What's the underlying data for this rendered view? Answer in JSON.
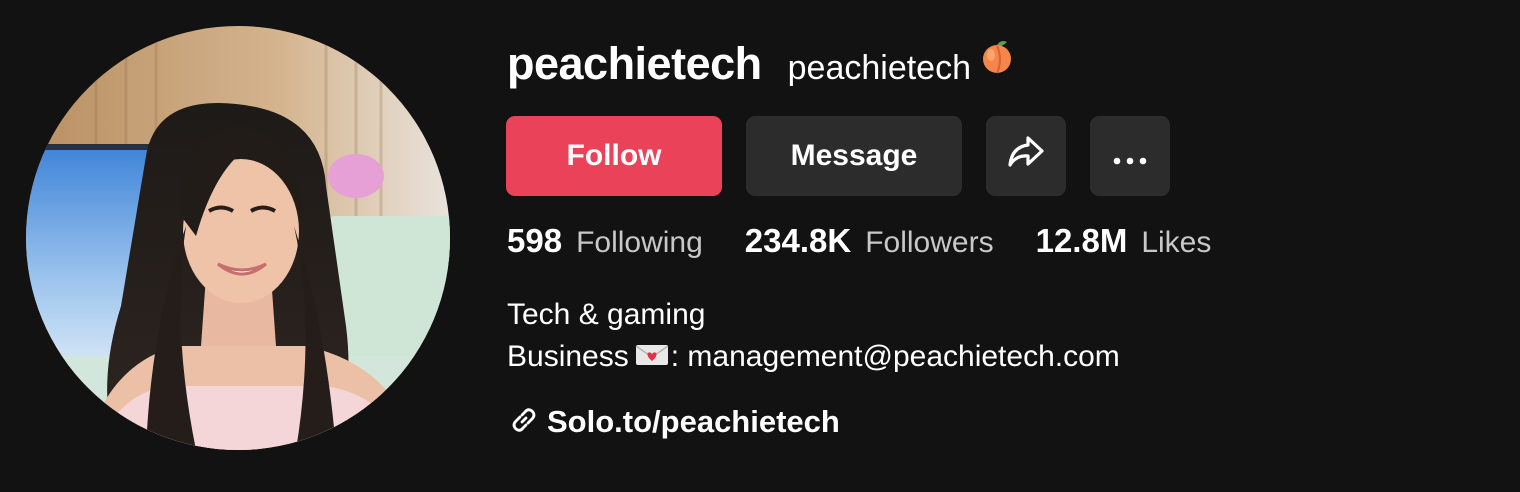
{
  "profile": {
    "username": "peachietech",
    "nickname": "peachietech",
    "nickname_emoji_icon": "peach-icon"
  },
  "actions": {
    "follow_label": "Follow",
    "message_label": "Message",
    "share_icon": "share-arrow-icon",
    "more_icon": "more-dots-icon"
  },
  "stats": [
    {
      "value": "598",
      "label": "Following"
    },
    {
      "value": "234.8K",
      "label": "Followers"
    },
    {
      "value": "12.8M",
      "label": "Likes"
    }
  ],
  "bio": {
    "line1": "Tech & gaming",
    "line2_prefix": "Business",
    "line2_emoji_icon": "love-letter-icon",
    "line2_suffix": ": management@peachietech.com"
  },
  "link": {
    "icon": "link-icon",
    "text": "Solo.to/peachietech"
  },
  "colors": {
    "background": "#121212",
    "follow_button": "#ea4359",
    "secondary_button": "#2c2c2c",
    "stat_label": "#c8c8c8"
  }
}
